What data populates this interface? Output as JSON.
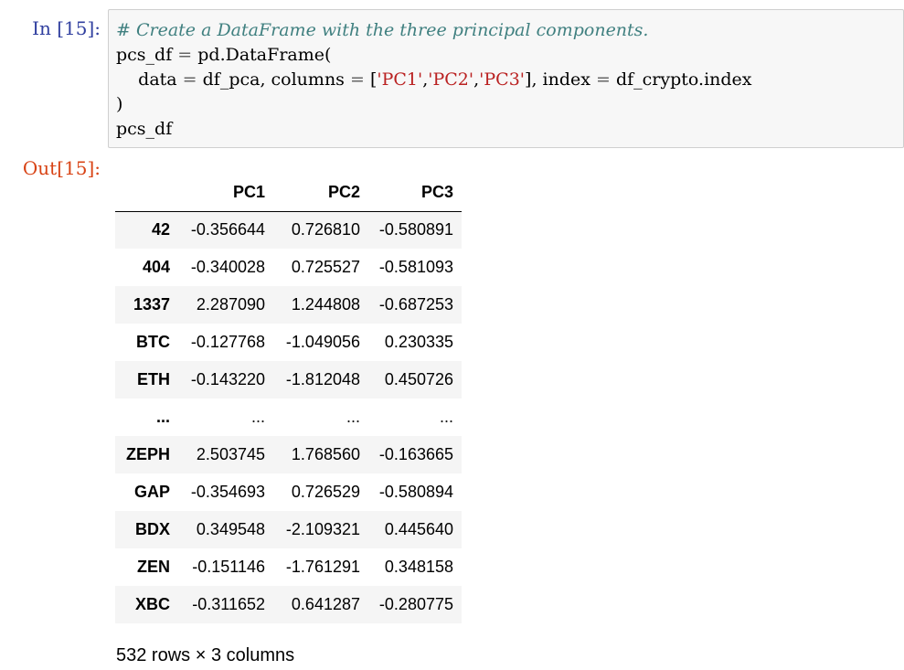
{
  "input_cell": {
    "prompt": "In [15]:",
    "code": {
      "comment": "# Create a DataFrame with the three principal components.",
      "line2_var": "pcs_df",
      "line2_eq": " = ",
      "line2_rest": "pd.DataFrame(",
      "line3_indent": "    ",
      "line3_arg1": "data",
      "line3_eq1": " = ",
      "line3_val1": "df_pca, columns",
      "line3_eq2": " = ",
      "line3_open": "[",
      "line3_s1": "'PC1'",
      "line3_c1": ",",
      "line3_s2": "'PC2'",
      "line3_c2": ",",
      "line3_s3": "'PC3'",
      "line3_close": "], index",
      "line3_eq3": " = ",
      "line3_val3": "df_crypto.index",
      "line4": ")",
      "line5": "pcs_df"
    }
  },
  "output_cell": {
    "prompt": "Out[15]:",
    "dataframe": {
      "columns": [
        "",
        "PC1",
        "PC2",
        "PC3"
      ],
      "rows": [
        {
          "index": "42",
          "pc1": "-0.356644",
          "pc2": "0.726810",
          "pc3": "-0.580891"
        },
        {
          "index": "404",
          "pc1": "-0.340028",
          "pc2": "0.725527",
          "pc3": "-0.581093"
        },
        {
          "index": "1337",
          "pc1": "2.287090",
          "pc2": "1.244808",
          "pc3": "-0.687253"
        },
        {
          "index": "BTC",
          "pc1": "-0.127768",
          "pc2": "-1.049056",
          "pc3": "0.230335"
        },
        {
          "index": "ETH",
          "pc1": "-0.143220",
          "pc2": "-1.812048",
          "pc3": "0.450726"
        },
        {
          "index": "...",
          "pc1": "...",
          "pc2": "...",
          "pc3": "..."
        },
        {
          "index": "ZEPH",
          "pc1": "2.503745",
          "pc2": "1.768560",
          "pc3": "-0.163665"
        },
        {
          "index": "GAP",
          "pc1": "-0.354693",
          "pc2": "0.726529",
          "pc3": "-0.580894"
        },
        {
          "index": "BDX",
          "pc1": "0.349548",
          "pc2": "-2.109321",
          "pc3": "0.445640"
        },
        {
          "index": "ZEN",
          "pc1": "-0.151146",
          "pc2": "-1.761291",
          "pc3": "0.348158"
        },
        {
          "index": "XBC",
          "pc1": "-0.311652",
          "pc2": "0.641287",
          "pc3": "-0.280775"
        }
      ],
      "shape_note": "532 rows × 3 columns"
    }
  },
  "colors": {
    "in_prompt": "#303f9f",
    "out_prompt": "#d84315",
    "comment": "#408080",
    "string": "#ba2121",
    "operator": "#666666",
    "input_background": "#f7f7f7",
    "input_border": "#cfcfcf",
    "row_stripe": "#f5f5f5"
  }
}
